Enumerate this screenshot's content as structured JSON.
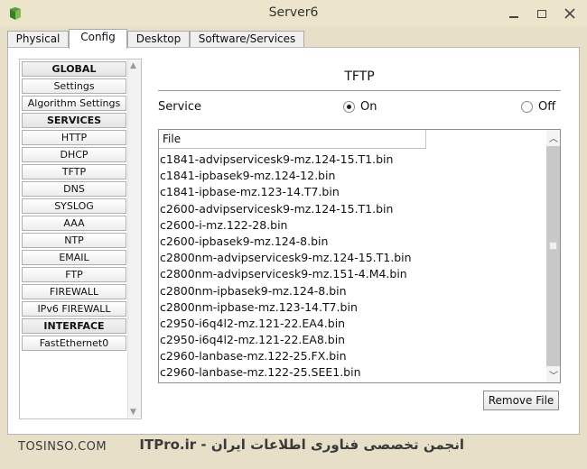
{
  "window": {
    "title": "Server6"
  },
  "tabs": [
    {
      "label": "Physical"
    },
    {
      "label": "Config"
    },
    {
      "label": "Desktop"
    },
    {
      "label": "Software/Services"
    }
  ],
  "sidebar": {
    "items": [
      {
        "label": "GLOBAL",
        "header": true
      },
      {
        "label": "Settings",
        "header": false
      },
      {
        "label": "Algorithm Settings",
        "header": false
      },
      {
        "label": "SERVICES",
        "header": true
      },
      {
        "label": "HTTP",
        "header": false
      },
      {
        "label": "DHCP",
        "header": false
      },
      {
        "label": "TFTP",
        "header": false
      },
      {
        "label": "DNS",
        "header": false
      },
      {
        "label": "SYSLOG",
        "header": false
      },
      {
        "label": "AAA",
        "header": false
      },
      {
        "label": "NTP",
        "header": false
      },
      {
        "label": "EMAIL",
        "header": false
      },
      {
        "label": "FTP",
        "header": false
      },
      {
        "label": "FIREWALL",
        "header": false
      },
      {
        "label": "IPv6 FIREWALL",
        "header": false
      },
      {
        "label": "INTERFACE",
        "header": true
      },
      {
        "label": "FastEthernet0",
        "header": false
      }
    ]
  },
  "main": {
    "title": "TFTP",
    "service_label": "Service",
    "on_label": "On",
    "off_label": "Off",
    "service_state": "on",
    "file_header": "File",
    "files": [
      "c1841-advipservicesk9-mz.124-15.T1.bin",
      "c1841-ipbasek9-mz.124-12.bin",
      "c1841-ipbase-mz.123-14.T7.bin",
      "c2600-advipservicesk9-mz.124-15.T1.bin",
      "c2600-i-mz.122-28.bin",
      "c2600-ipbasek9-mz.124-8.bin",
      "c2800nm-advipservicesk9-mz.124-15.T1.bin",
      "c2800nm-advipservicesk9-mz.151-4.M4.bin",
      "c2800nm-ipbasek9-mz.124-8.bin",
      "c2800nm-ipbase-mz.123-14.T7.bin",
      "c2950-i6q4l2-mz.121-22.EA4.bin",
      "c2950-i6q4l2-mz.121-22.EA8.bin",
      "c2960-lanbase-mz.122-25.FX.bin",
      "c2960-lanbase-mz.122-25.SEE1.bin"
    ],
    "remove_label": "Remove File"
  },
  "footer": {
    "left": "TOSINSO.COM",
    "right": "ITPro.ir - انجمن تخصصی فناوری اطلاعات ایران"
  },
  "colors": {
    "frame_bg": "#e8dfc9",
    "panel_bg": "#ffffff",
    "scroll_track": "#c8c8c8"
  }
}
